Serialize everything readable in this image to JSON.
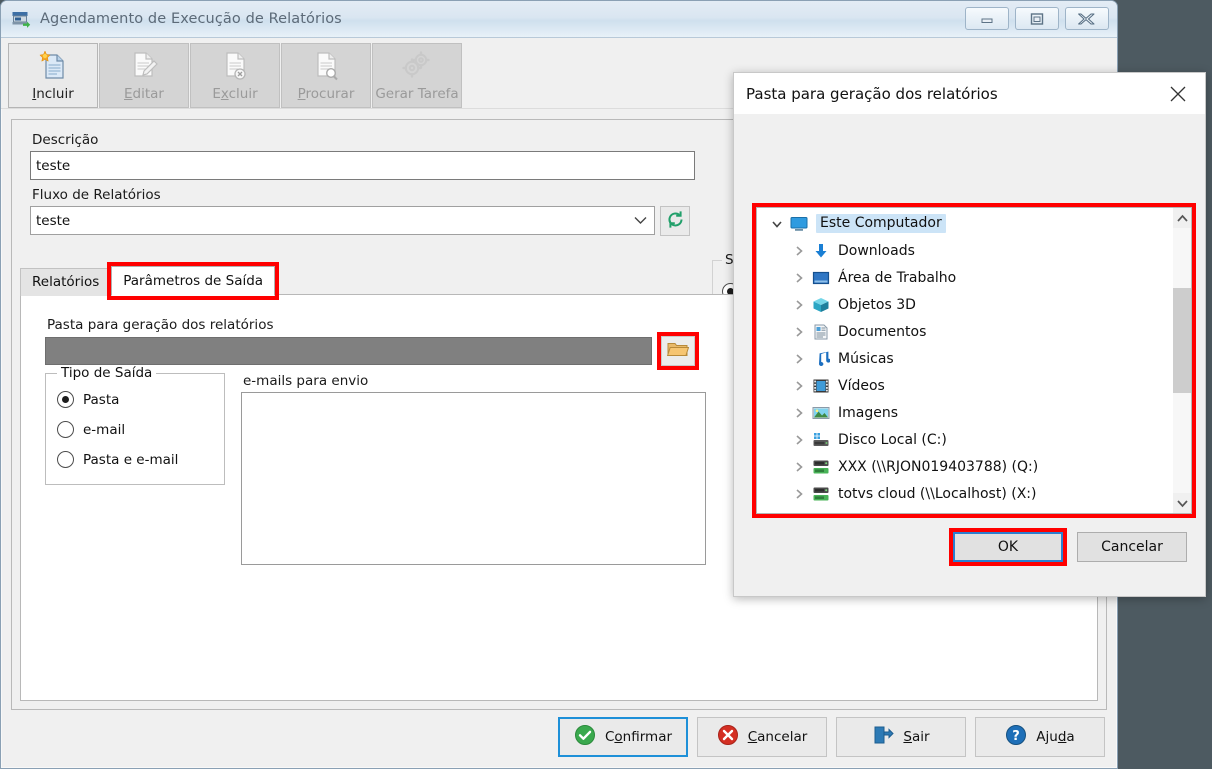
{
  "window": {
    "title": "Agendamento de Execução de Relatórios",
    "app_icon": "scheduler-icon",
    "controls": {
      "minimize": "minimize-icon",
      "maximize": "maximize-icon",
      "close": "close-icon"
    }
  },
  "toolbar": {
    "buttons": [
      {
        "label": "Incluir",
        "accel": "I",
        "icon": "new-document-icon",
        "enabled": true
      },
      {
        "label": "Editar",
        "accel": "E",
        "icon": "edit-document-icon",
        "enabled": false
      },
      {
        "label": "Excluir",
        "accel": "x",
        "icon": "delete-document-icon",
        "enabled": false
      },
      {
        "label": "Procurar",
        "accel": "P",
        "icon": "search-document-icon",
        "enabled": false
      },
      {
        "label": "Gerar Tarefa",
        "accel": "",
        "icon": "gears-icon",
        "enabled": false
      }
    ]
  },
  "form": {
    "descricao_label": "Descrição",
    "descricao_value": "teste",
    "fluxo_label": "Fluxo de Relatórios",
    "fluxo_value": "teste",
    "refresh_icon": "refresh-icon",
    "status_group_label": "St"
  },
  "tabs": [
    {
      "label": "Relatórios",
      "selected": false
    },
    {
      "label": "Parâmetros de Saída",
      "selected": true,
      "highlighted": true
    }
  ],
  "panel": {
    "pasta_label": "Pasta para geração dos relatórios",
    "pasta_value": "",
    "browse_icon": "folder-open-icon",
    "tipo_saida": {
      "legend": "Tipo de Saída",
      "options": [
        {
          "label": "Pasta",
          "selected": true
        },
        {
          "label": "e-mail",
          "selected": false
        },
        {
          "label": "Pasta e e-mail",
          "selected": false
        }
      ]
    },
    "emails_label": "e-mails para envio",
    "emails_value": ""
  },
  "footer": {
    "buttons": [
      {
        "label": "Confirmar",
        "accel": "o",
        "icon": "check-circle-icon",
        "focused": true
      },
      {
        "label": "Cancelar",
        "accel": "C",
        "icon": "x-circle-icon",
        "focused": false
      },
      {
        "label": "Sair",
        "accel": "S",
        "icon": "exit-door-icon",
        "focused": false
      },
      {
        "label": "Ajuda",
        "accel": "d",
        "icon": "question-circle-icon",
        "focused": false
      }
    ]
  },
  "dialog": {
    "title": "Pasta para geração dos relatórios",
    "close_icon": "close-icon",
    "tree": [
      {
        "label": "Este Computador",
        "icon": "monitor-icon",
        "expanded": true,
        "selected": true,
        "level": 0
      },
      {
        "label": "Downloads",
        "icon": "download-arrow-icon",
        "expanded": false,
        "selected": false,
        "level": 1
      },
      {
        "label": "Área de Trabalho",
        "icon": "desktop-icon",
        "expanded": false,
        "selected": false,
        "level": 1
      },
      {
        "label": "Objetos 3D",
        "icon": "cube-3d-icon",
        "expanded": false,
        "selected": false,
        "level": 1
      },
      {
        "label": "Documentos",
        "icon": "document-icon",
        "expanded": false,
        "selected": false,
        "level": 1
      },
      {
        "label": "Músicas",
        "icon": "music-note-icon",
        "expanded": false,
        "selected": false,
        "level": 1
      },
      {
        "label": "Vídeos",
        "icon": "film-icon",
        "expanded": false,
        "selected": false,
        "level": 1
      },
      {
        "label": "Imagens",
        "icon": "picture-icon",
        "expanded": false,
        "selected": false,
        "level": 1
      },
      {
        "label": "Disco Local (C:)",
        "icon": "hard-drive-icon",
        "expanded": false,
        "selected": false,
        "level": 1
      },
      {
        "label": "XXX (\\\\RJON019403788) (Q:)",
        "icon": "network-drive-icon",
        "expanded": false,
        "selected": false,
        "level": 1
      },
      {
        "label": "totvs cloud (\\\\Localhost) (X:)",
        "icon": "network-drive-icon",
        "expanded": false,
        "selected": false,
        "level": 1
      }
    ],
    "scrollbar": {
      "up_icon": "chevron-up-icon",
      "down_icon": "chevron-down-icon"
    },
    "buttons": [
      {
        "label": "OK",
        "focused": true,
        "highlighted": true
      },
      {
        "label": "Cancelar",
        "focused": false,
        "highlighted": false
      }
    ]
  },
  "colors": {
    "highlight_red": "#ff0000",
    "focus_blue": "#1e90d8",
    "selection_blue": "#cce4f7",
    "desktop_bg": "#4d5a61",
    "window_bg": "#f0f0f0"
  }
}
